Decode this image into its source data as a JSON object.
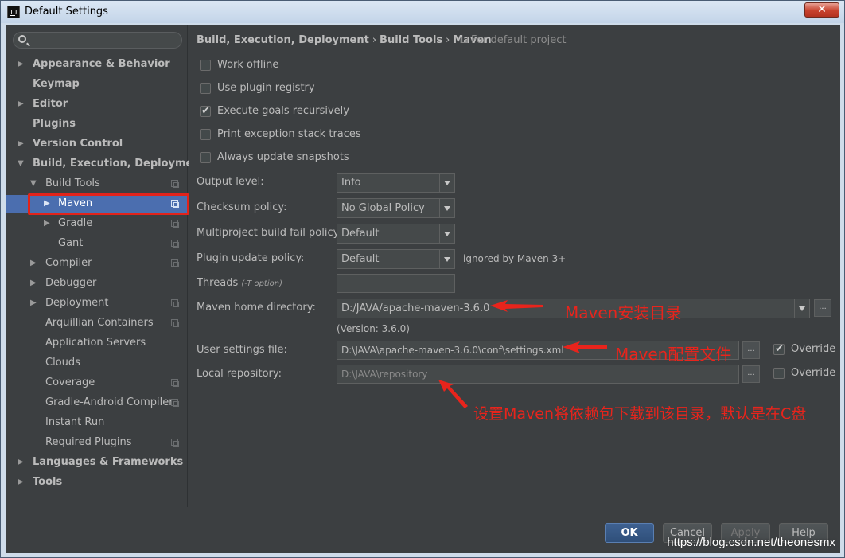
{
  "window": {
    "title": "Default Settings",
    "close_label": "✕"
  },
  "search": {
    "placeholder": ""
  },
  "sidebar": {
    "items": [
      {
        "label": "Appearance & Behavior",
        "arrow": "▶"
      },
      {
        "label": "Keymap",
        "arrow": ""
      },
      {
        "label": "Editor",
        "arrow": "▶"
      },
      {
        "label": "Plugins",
        "arrow": ""
      },
      {
        "label": "Version Control",
        "arrow": "▶"
      },
      {
        "label": "Build, Execution, Deployment",
        "arrow": "▼"
      },
      {
        "label": "Build Tools",
        "arrow": "▼"
      },
      {
        "label": "Maven",
        "arrow": "▶"
      },
      {
        "label": "Gradle",
        "arrow": "▶"
      },
      {
        "label": "Gant",
        "arrow": ""
      },
      {
        "label": "Compiler",
        "arrow": "▶"
      },
      {
        "label": "Debugger",
        "arrow": "▶"
      },
      {
        "label": "Deployment",
        "arrow": "▶"
      },
      {
        "label": "Arquillian Containers",
        "arrow": ""
      },
      {
        "label": "Application Servers",
        "arrow": ""
      },
      {
        "label": "Clouds",
        "arrow": ""
      },
      {
        "label": "Coverage",
        "arrow": ""
      },
      {
        "label": "Gradle-Android Compiler",
        "arrow": ""
      },
      {
        "label": "Instant Run",
        "arrow": ""
      },
      {
        "label": "Required Plugins",
        "arrow": ""
      },
      {
        "label": "Languages & Frameworks",
        "arrow": "▶"
      },
      {
        "label": "Tools",
        "arrow": "▶"
      }
    ]
  },
  "breadcrumb": {
    "part1": "Build, Execution, Deployment",
    "sep": "›",
    "part2": "Build Tools",
    "part3": "Maven",
    "note": "For default project"
  },
  "options": {
    "work_offline": "Work offline",
    "use_plugin_registry": "Use plugin registry",
    "execute_goals_recursively": "Execute goals recursively",
    "print_exception": "Print exception stack traces",
    "always_update_snapshots": "Always update snapshots"
  },
  "fields": {
    "output_level_label": "Output level:",
    "output_level_value": "Info",
    "checksum_label": "Checksum policy:",
    "checksum_value": "No Global Policy",
    "multiproject_label": "Multiproject build fail policy:",
    "multiproject_value": "Default",
    "plugin_update_label": "Plugin update policy:",
    "plugin_update_value": "Default",
    "plugin_update_note": "ignored by Maven 3+",
    "threads_label": "Threads",
    "threads_hint": "(-T option)",
    "threads_value": "",
    "maven_home_label": "Maven home directory:",
    "maven_home_value": "D:/JAVA/apache-maven-3.6.0",
    "version_note": "(Version: 3.6.0)",
    "user_settings_label": "User settings file:",
    "user_settings_value": "D:\\JAVA\\apache-maven-3.6.0\\conf\\settings.xml",
    "local_repo_label": "Local repository:",
    "local_repo_value": "D:\\JAVA\\repository",
    "override_label": "Override",
    "dots_label": "..."
  },
  "annotations": {
    "maven_home": "Maven安装目录",
    "settings_file": "Maven配置文件",
    "repository": "设置Maven将依赖包下载到该目录，默认是在C盘"
  },
  "footer": {
    "ok": "OK",
    "cancel": "Cancel",
    "apply": "Apply",
    "help": "Help",
    "watermark": "https://blog.csdn.net/theonesmx"
  },
  "colors": {
    "selection": "#4b6eaf",
    "annotation": "#e8241c",
    "background": "#3c3f41"
  }
}
